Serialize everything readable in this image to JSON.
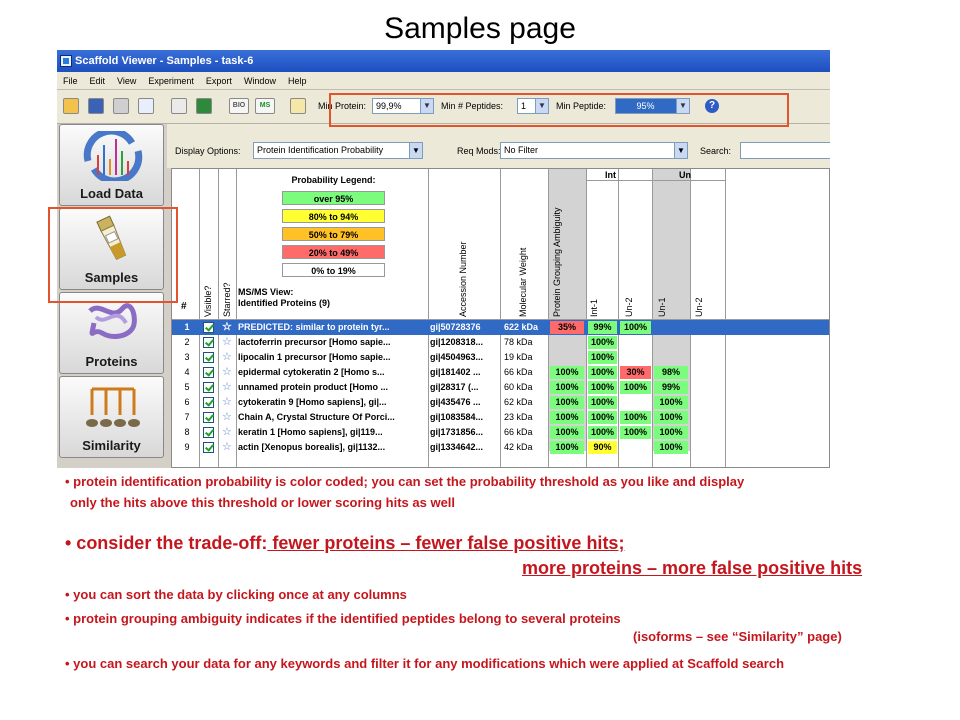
{
  "slide": {
    "title": "Samples page"
  },
  "window": {
    "title": "Scaffold Viewer - Samples - task-6",
    "menu": [
      "File",
      "Edit",
      "View",
      "Experiment",
      "Export",
      "Window",
      "Help"
    ]
  },
  "toolbar": {
    "min_protein_label": "Min Protein:",
    "min_protein_value": "99,9%",
    "min_peptides_label": "Min # Peptides:",
    "min_peptides_value": "1",
    "min_peptide_label": "Min Peptide:",
    "min_peptide_value": "95%",
    "icon_bio": "BIO",
    "icon_ms": "MS"
  },
  "nav": {
    "items": [
      {
        "label": "Load Data",
        "icon": "chart-icon"
      },
      {
        "label": "Samples",
        "icon": "vial-icon"
      },
      {
        "label": "Proteins",
        "icon": "protein-icon"
      },
      {
        "label": "Similarity",
        "icon": "tree-icon"
      }
    ]
  },
  "options": {
    "display_label": "Display Options:",
    "display_value": "Protein Identification Probability",
    "reqmods_label": "Req Mods:",
    "reqmods_value": "No Filter",
    "search_label": "Search:"
  },
  "legend": {
    "title": "Probability Legend:",
    "items": [
      {
        "label": "over 95%",
        "color": "#7cfc7c"
      },
      {
        "label": "80% to 94%",
        "color": "#ffff33"
      },
      {
        "label": "50% to 79%",
        "color": "#ffc125"
      },
      {
        "label": "20% to  49%",
        "color": "#ff6b6b"
      },
      {
        "label": "0% to 19%",
        "color": "#ffffff"
      }
    ]
  },
  "table": {
    "hash": "#",
    "visible_header": "Visible?",
    "starred_header": "Starred?",
    "view_title_line1": "MS/MS View:",
    "view_title_line2": "Identified Proteins (9)",
    "accession_header": "Accession Number",
    "mw_header": "Molecular Weight",
    "ambiguity_header": "Protein Grouping Ambiguity",
    "group_int": "Int",
    "group_un": "Un",
    "sample_headers": [
      "Int-1",
      "Un-2",
      "Un-1",
      "Un-2"
    ],
    "rows": [
      {
        "num": "1",
        "name": "PREDICTED: similar to protein tyr...",
        "acc": "gi|50728376",
        "mw": "622 kDa",
        "amb": false,
        "p": [
          "35%",
          "99%",
          "100%",
          ""
        ]
      },
      {
        "num": "2",
        "name": "lactoferrin precursor [Homo sapie...",
        "acc": "gi|1208318...",
        "mw": "78 kDa",
        "amb": false,
        "p": [
          "",
          "100%",
          "",
          ""
        ]
      },
      {
        "num": "3",
        "name": "lipocalin 1 precursor [Homo sapie...",
        "acc": "gi|4504963...",
        "mw": "19 kDa",
        "amb": false,
        "p": [
          "",
          "100%",
          "",
          ""
        ]
      },
      {
        "num": "4",
        "name": "epidermal cytokeratin 2 [Homo s...",
        "acc": "gi|181402 ...",
        "mw": "66 kDa",
        "amb": true,
        "p": [
          "100%",
          "100%",
          "30%",
          "98%"
        ]
      },
      {
        "num": "5",
        "name": "unnamed protein product [Homo ...",
        "acc": "gi|28317 (...",
        "mw": "60 kDa",
        "amb": false,
        "p": [
          "100%",
          "100%",
          "100%",
          "99%"
        ]
      },
      {
        "num": "6",
        "name": "cytokeratin 9 [Homo sapiens], gi|...",
        "acc": "gi|435476 ...",
        "mw": "62 kDa",
        "amb": false,
        "p": [
          "100%",
          "100%",
          "",
          "100%"
        ]
      },
      {
        "num": "7",
        "name": "Chain A, Crystal Structure Of Porci...",
        "acc": "gi|1083584...",
        "mw": "23 kDa",
        "amb": false,
        "p": [
          "100%",
          "100%",
          "100%",
          "100%"
        ]
      },
      {
        "num": "8",
        "name": "keratin 1 [Homo sapiens], gi|119...",
        "acc": "gi|1731856...",
        "mw": "66 kDa",
        "amb": true,
        "p": [
          "100%",
          "100%",
          "100%",
          "100%"
        ]
      },
      {
        "num": "9",
        "name": "actin [Xenopus borealis], gi|1132...",
        "acc": "gi|1334642...",
        "mw": "42 kDa",
        "amb": false,
        "p": [
          "100%",
          "90%",
          "",
          "100%"
        ]
      }
    ]
  },
  "bullets": {
    "b1_line1": "• protein identification  probability is color coded; you can set the probability threshold as you like and display",
    "b1_line2": "only the hits above this threshold or lower scoring hits as well",
    "b2_lead": "• consider the trade-off:",
    "b2_part1": " fewer proteins – fewer false positive hits;",
    "b2_part2": "more proteins – more false positive hits",
    "b3": "• you can sort the data by clicking once at any columns",
    "b4_line1": "• protein grouping ambiguity indicates if the identified peptides belong to several proteins",
    "b4_line2": "(isoforms – see “Similarity” page)",
    "b5": "• you can search your data for any keywords and filter it for any modifications which were applied at Scaffold search"
  },
  "colors": {
    "accent_red": "#c5161d",
    "frame_red": "#e2542b",
    "selection_blue": "#316ac5",
    "over95": "#7cfc7c",
    "p80_94": "#ffff33",
    "p50_79": "#ffc125",
    "p20_49": "#ff6b6b"
  }
}
